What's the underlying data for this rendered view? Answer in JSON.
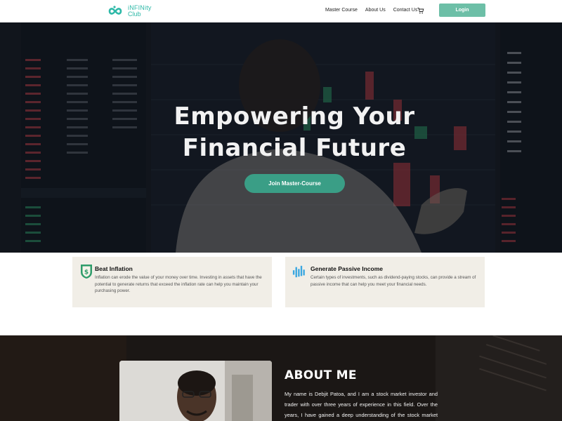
{
  "nav": {
    "logo_line1": "iNFINity",
    "logo_line2": "Club",
    "links": [
      "Master Course",
      "About Us",
      "Contact Us"
    ],
    "login_label": "Login",
    "cart_icon": "cart-icon"
  },
  "hero": {
    "title_line1": "Empowering Your",
    "title_line2": "Financial Future",
    "cta_label": "Join Master-Course"
  },
  "features": [
    {
      "icon": "shield-dollar-icon",
      "title": "Beat Inflation",
      "text": "Inflation can erode the value of your money over time. Investing in assets that have the potential to generate returns that exceed the inflation rate can help you maintain your purchasing power."
    },
    {
      "icon": "bar-chart-icon",
      "title": "Generate Passive Income",
      "text": "Certain types of investments, such as dividend-paying stocks, can provide a stream of passive income that can help you meet your financial needs."
    }
  ],
  "about": {
    "title": "ABOUT ME",
    "text": "My name is Debjit Patoa, and I am a stock market investor and trader with over three years of experience in this field. Over the years, I have gained a deep understanding of the stock market and its various intricacies. I am passionate"
  },
  "colors": {
    "accent": "#6dbfa7",
    "cta": "#3a9e86",
    "logo": "#2fb9a8",
    "feature_bg": "#f1eee7"
  }
}
